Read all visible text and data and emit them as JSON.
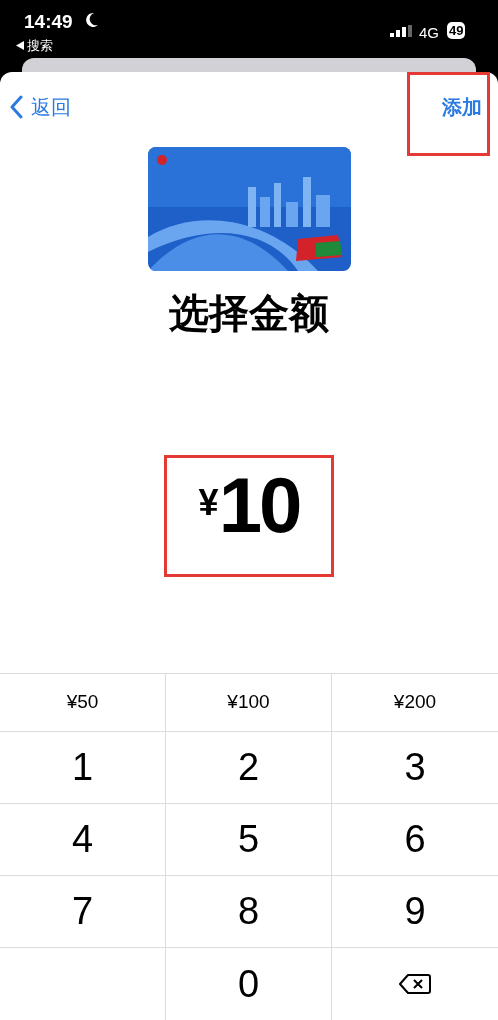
{
  "status_bar": {
    "time": "14:49",
    "back_app": "搜索",
    "network": "4G",
    "battery": "49"
  },
  "nav": {
    "back": "返回",
    "add": "添加"
  },
  "title": "选择金额",
  "amount": {
    "currency": "¥",
    "value": "10"
  },
  "presets": [
    "¥50",
    "¥100",
    "¥200"
  ],
  "keys": [
    {
      "kind": "digit",
      "label": "1"
    },
    {
      "kind": "digit",
      "label": "2"
    },
    {
      "kind": "digit",
      "label": "3"
    },
    {
      "kind": "digit",
      "label": "4"
    },
    {
      "kind": "digit",
      "label": "5"
    },
    {
      "kind": "digit",
      "label": "6"
    },
    {
      "kind": "digit",
      "label": "7"
    },
    {
      "kind": "digit",
      "label": "8"
    },
    {
      "kind": "digit",
      "label": "9"
    },
    {
      "kind": "empty"
    },
    {
      "kind": "digit",
      "label": "0"
    },
    {
      "kind": "delete"
    }
  ]
}
